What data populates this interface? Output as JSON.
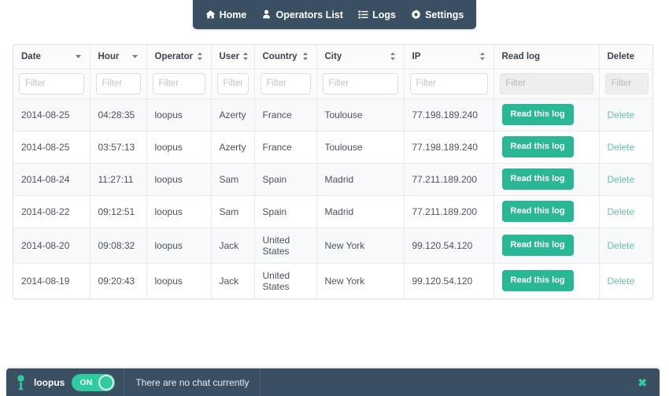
{
  "navbar": {
    "items": [
      {
        "label": "Home",
        "icon": "home-icon"
      },
      {
        "label": "Operators List",
        "icon": "user-icon"
      },
      {
        "label": "Logs",
        "icon": "list-icon"
      },
      {
        "label": "Settings",
        "icon": "gear-icon"
      }
    ]
  },
  "table": {
    "columns": [
      {
        "label": "Date",
        "sort": "desc",
        "filter_placeholder": "Filter",
        "filter_value": "",
        "filter_disabled": false
      },
      {
        "label": "Hour",
        "sort": "desc",
        "filter_placeholder": "Filter",
        "filter_value": "",
        "filter_disabled": false
      },
      {
        "label": "Operator",
        "sort": "both",
        "filter_placeholder": "Filter",
        "filter_value": "",
        "filter_disabled": false
      },
      {
        "label": "User",
        "sort": "both",
        "filter_placeholder": "Filter",
        "filter_value": "",
        "filter_disabled": false
      },
      {
        "label": "Country",
        "sort": "both",
        "filter_placeholder": "Filter",
        "filter_value": "",
        "filter_disabled": false
      },
      {
        "label": "City",
        "sort": "both",
        "filter_placeholder": "Filter",
        "filter_value": "",
        "filter_disabled": false
      },
      {
        "label": "IP",
        "sort": "both",
        "filter_placeholder": "Filter",
        "filter_value": "",
        "filter_disabled": false
      },
      {
        "label": "Read log",
        "sort": "none",
        "filter_placeholder": "Filter",
        "filter_value": "",
        "filter_disabled": true
      },
      {
        "label": "Delete",
        "sort": "none",
        "filter_placeholder": "Filter",
        "filter_value": "",
        "filter_disabled": true
      }
    ],
    "rows": [
      {
        "date": "2014-08-25",
        "hour": "04:28:35",
        "operator": "loopus",
        "user": "Azerty",
        "country": "France",
        "city": "Toulouse",
        "ip": "77.198.189.240",
        "read_label": "Read this log",
        "delete_label": "Delete"
      },
      {
        "date": "2014-08-25",
        "hour": "03:57:13",
        "operator": "loopus",
        "user": "Azerty",
        "country": "France",
        "city": "Toulouse",
        "ip": "77.198.189.240",
        "read_label": "Read this log",
        "delete_label": "Delete"
      },
      {
        "date": "2014-08-24",
        "hour": "11:27:11",
        "operator": "loopus",
        "user": "Sam",
        "country": "Spain",
        "city": "Madrid",
        "ip": "77.211.189.200",
        "read_label": "Read this log",
        "delete_label": "Delete"
      },
      {
        "date": "2014-08-22",
        "hour": "09:12:51",
        "operator": "loopus",
        "user": "Sam",
        "country": "Spain",
        "city": "Madrid",
        "ip": "77.211.189.200",
        "read_label": "Read this log",
        "delete_label": "Delete"
      },
      {
        "date": "2014-08-20",
        "hour": "09:08:32",
        "operator": "loopus",
        "user": "Jack",
        "country": "United States",
        "city": "New York",
        "ip": "99.120.54.120",
        "read_label": "Read this log",
        "delete_label": "Delete"
      },
      {
        "date": "2014-08-19",
        "hour": "09:20:43",
        "operator": "loopus",
        "user": "Jack",
        "country": "United States",
        "city": "New York",
        "ip": "99.120.54.120",
        "read_label": "Read this log",
        "delete_label": "Delete"
      }
    ]
  },
  "chatbar": {
    "user": "loopus",
    "toggle_label": "ON",
    "toggle_state": "on",
    "message": "There are no chat currently",
    "close_label": "✖"
  },
  "colors": {
    "navbar_bg": "#3b4f63",
    "accent_teal": "#2ab795",
    "toggle_green": "#2ecc9e",
    "delete_link": "#68c2ab",
    "row_stripe": "#f8f9fa",
    "border": "#e8eaec"
  }
}
